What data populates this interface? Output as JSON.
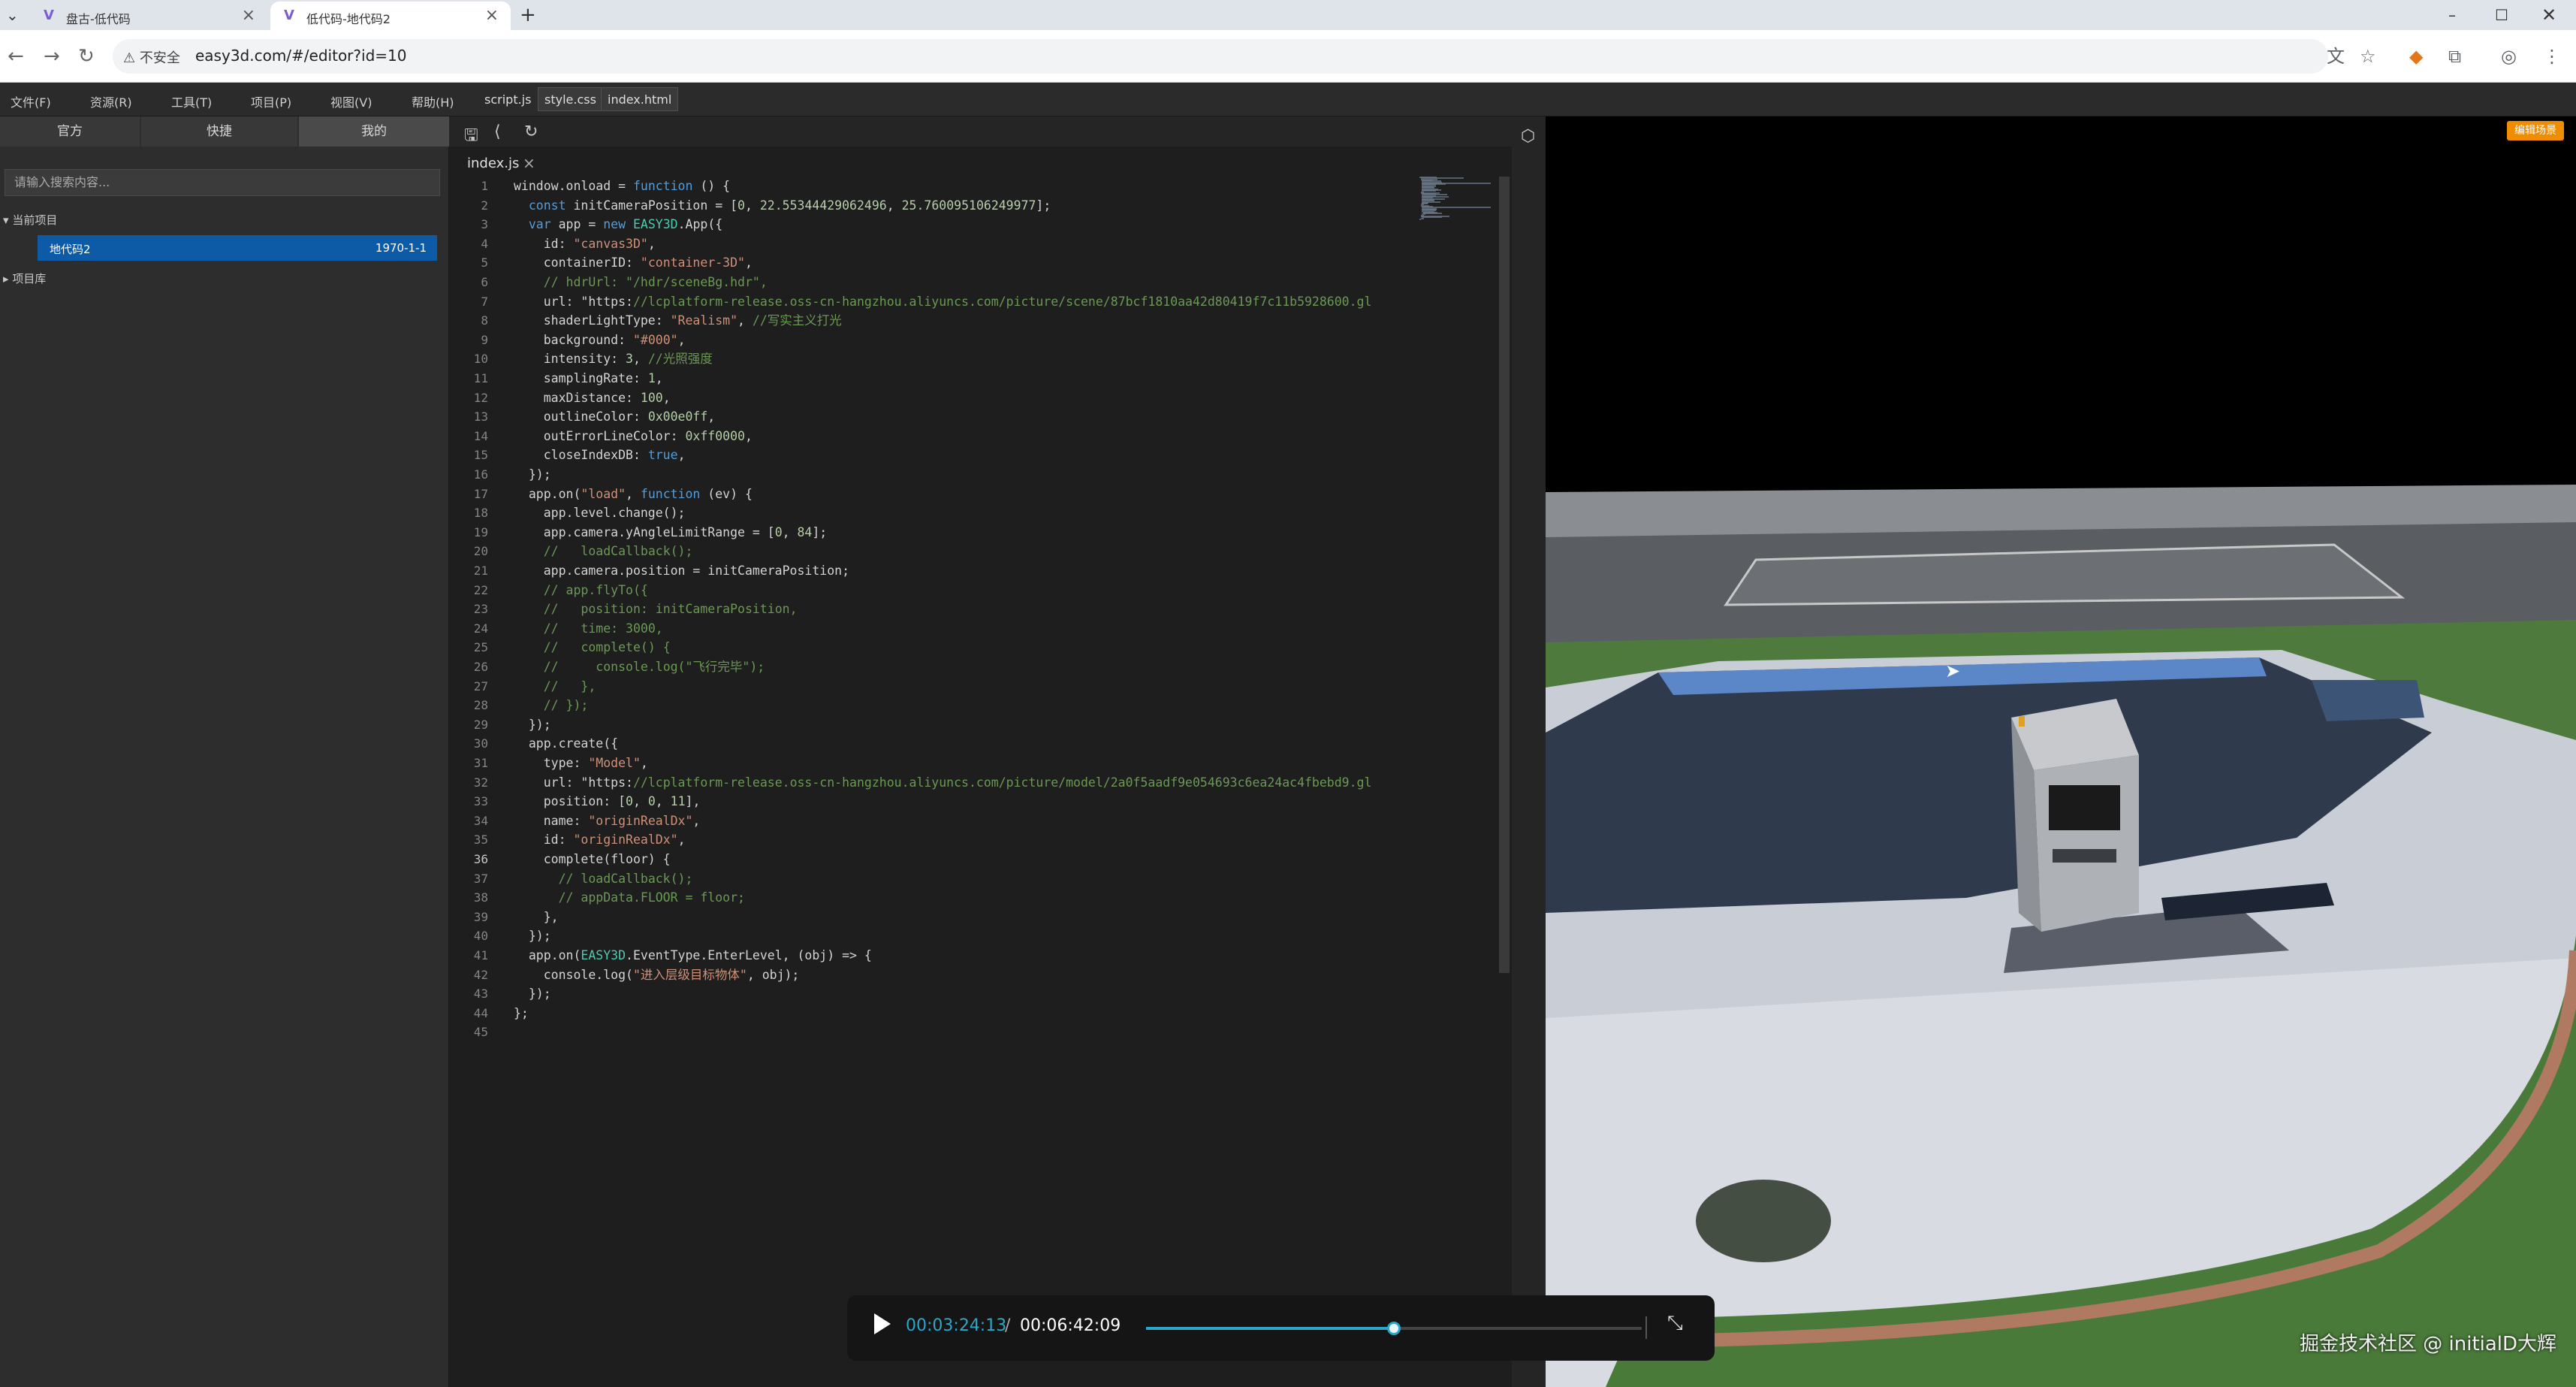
{
  "browser": {
    "tabs": [
      {
        "title": "盘古-低代码"
      },
      {
        "title": "低代码-地代码2"
      }
    ],
    "new_tab": "+",
    "security_label": "不安全",
    "url": "easy3d.com/#/editor?id=10"
  },
  "menubar": {
    "items": [
      "文件(F)",
      "资源(R)",
      "工具(T)",
      "项目(P)",
      "视图(V)",
      "帮助(H)"
    ],
    "file_tabs": [
      "script.js",
      "style.css",
      "index.html"
    ]
  },
  "left_panel": {
    "tabs": [
      "官方",
      "快捷",
      "我的"
    ],
    "search_placeholder": "请输入搜索内容...",
    "section_current": "当前项目",
    "project_name": "地代码2",
    "project_date": "1970-1-1",
    "section_library": "项目库"
  },
  "editor": {
    "tab_name": "index.js",
    "current_line": 36
  },
  "viewport": {
    "edit_scene_button": "编辑场景"
  },
  "video": {
    "current_time": "00:03:24:13",
    "separator": "/",
    "total_time": "00:06:42:09",
    "progress": 0.5
  },
  "watermark": "掘金技术社区 @ initialD大辉",
  "code_lines": [
    "window.onload = function () {",
    "  const initCameraPosition = [0, 22.55344429062496, 25.760095106249977];",
    "  var app = new EASY3D.App({",
    "    id: \"canvas3D\",",
    "    containerID: \"container-3D\",",
    "    // hdrUrl: \"/hdr/sceneBg.hdr\",",
    "    url: \"https://lcplatform-release.oss-cn-hangzhou.aliyuncs.com/picture/scene/87bcf1810aa42d80419f7c11b5928600.gl",
    "    shaderLightType: \"Realism\", //写实主义打光",
    "    background: \"#000\",",
    "    intensity: 3, //光照强度",
    "    samplingRate: 1,",
    "    maxDistance: 100,",
    "    outlineColor: 0x00e0ff,",
    "    outErrorLineColor: 0xff0000,",
    "    closeIndexDB: true,",
    "  });",
    "  app.on(\"load\", function (ev) {",
    "    app.level.change();",
    "    app.camera.yAngleLimitRange = [0, 84];",
    "    //   loadCallback();",
    "    app.camera.position = initCameraPosition;",
    "    // app.flyTo({",
    "    //   position: initCameraPosition,",
    "    //   time: 3000,",
    "    //   complete() {",
    "    //     console.log(\"飞行完毕\");",
    "    //   },",
    "    // });",
    "  });",
    "  app.create({",
    "    type: \"Model\",",
    "    url: \"https://lcplatform-release.oss-cn-hangzhou.aliyuncs.com/picture/model/2a0f5aadf9e054693c6ea24ac4fbebd9.gl",
    "    position: [0, 0, 11],",
    "    name: \"originRealDx\",",
    "    id: \"originRealDx\",",
    "    complete(floor) {",
    "      // loadCallback();",
    "      // appData.FLOOR = floor;",
    "    },",
    "  });",
    "  app.on(EASY3D.EventType.EnterLevel, (obj) => {",
    "    console.log(\"进入层级目标物体\", obj);",
    "  });",
    "};",
    ""
  ]
}
